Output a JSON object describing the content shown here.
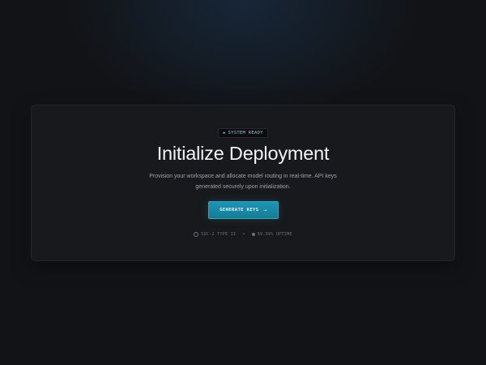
{
  "badge": {
    "icon": "status-dot-icon",
    "label": "SYSTEM READY"
  },
  "hero": {
    "title": "Initialize Deployment",
    "subtitle": "Provision your workspace and allocate model routing in real-time. API keys generated securely upon initialization."
  },
  "cta": {
    "label": "GENERATE KEYS",
    "icon": "arrow-right-icon"
  },
  "footer": {
    "compliance": "SOC-2 TYPE II",
    "separator": "•",
    "uptime": "99.99% UPTIME"
  },
  "colors": {
    "accent": "#1e95b4",
    "background": "#121316",
    "card": "#18191c"
  }
}
